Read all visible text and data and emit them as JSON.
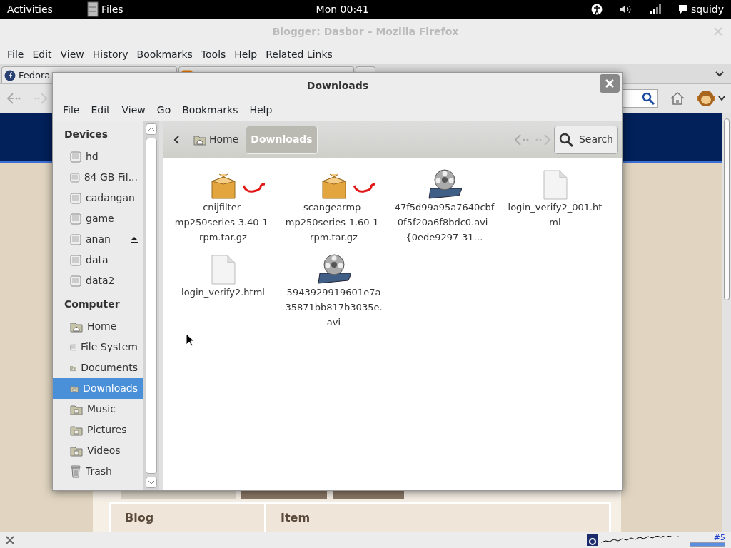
{
  "top_bar": {
    "activities": "Activities",
    "app": "Files",
    "clock": "Mon 00:41",
    "user": "squidy"
  },
  "firefox": {
    "title": "Blogger: Dasbor – Mozilla Firefox",
    "menu": [
      "File",
      "Edit",
      "View",
      "History",
      "Bookmarks",
      "Tools",
      "Help",
      "Related Links"
    ],
    "tabs": [
      {
        "kind": "fedora",
        "label": "Fedora"
      },
      {
        "kind": "blogger"
      }
    ],
    "page": {
      "tabs": [
        {
          "selected": true
        },
        {
          "selected": false
        },
        {
          "selected": false
        }
      ],
      "table_headers": [
        "Blog",
        "Item"
      ]
    },
    "status_bar": {
      "counter": "#5",
      "level": 1
    }
  },
  "dialog": {
    "title": "Downloads",
    "menu": [
      "File",
      "Edit",
      "View",
      "Go",
      "Bookmarks",
      "Help"
    ],
    "sidebar": [
      {
        "heading": "Devices",
        "items": [
          {
            "label": "hd",
            "kind": "drive",
            "eject": false,
            "selected": false
          },
          {
            "label": "84 GB Fil...",
            "kind": "drive",
            "eject": false,
            "selected": false
          },
          {
            "label": "cadangan",
            "kind": "drive",
            "eject": false,
            "selected": false
          },
          {
            "label": "game",
            "kind": "drive",
            "eject": false,
            "selected": false
          },
          {
            "label": "anan",
            "kind": "drive",
            "eject": true,
            "selected": false
          },
          {
            "label": "data",
            "kind": "drive",
            "eject": false,
            "selected": false
          },
          {
            "label": "data2",
            "kind": "drive",
            "eject": false,
            "selected": false
          }
        ]
      },
      {
        "heading": "Computer",
        "items": [
          {
            "label": "Home",
            "kind": "home",
            "eject": false,
            "selected": false
          },
          {
            "label": "File System",
            "kind": "drive",
            "eject": false,
            "selected": false
          },
          {
            "label": "Documents",
            "kind": "folder",
            "eject": false,
            "selected": false
          },
          {
            "label": "Downloads",
            "kind": "folder",
            "eject": false,
            "selected": true
          },
          {
            "label": "Music",
            "kind": "folder",
            "eject": false,
            "selected": false
          },
          {
            "label": "Pictures",
            "kind": "folder",
            "eject": false,
            "selected": false
          },
          {
            "label": "Videos",
            "kind": "folder",
            "eject": false,
            "selected": false
          },
          {
            "label": "Trash",
            "kind": "trash",
            "eject": false,
            "selected": false
          }
        ]
      }
    ],
    "path": [
      {
        "label": "Home",
        "kind": "home",
        "selected": false
      },
      {
        "label": "Downloads",
        "selected": true
      }
    ],
    "search": "Search",
    "files": [
      {
        "name": "cnijfilter-mp250series-3.40-1-rpm.tar.gz",
        "kind": "package",
        "marked": true
      },
      {
        "name": "scangearmp-mp250series-1.60-1-rpm.tar.gz",
        "kind": "package",
        "marked": true
      },
      {
        "name": "47f5d99a95a7640cbf0f5f20a6f8bdc0.avi-{0ede9297-31…",
        "kind": "video",
        "marked": false
      },
      {
        "name": "login_verify2_001.html",
        "kind": "document",
        "marked": false
      },
      {
        "name": "login_verify2.html",
        "kind": "document",
        "marked": false
      },
      {
        "name": "5943929919601e7a35871bb817b3035e.avi",
        "kind": "video",
        "marked": false
      }
    ]
  }
}
